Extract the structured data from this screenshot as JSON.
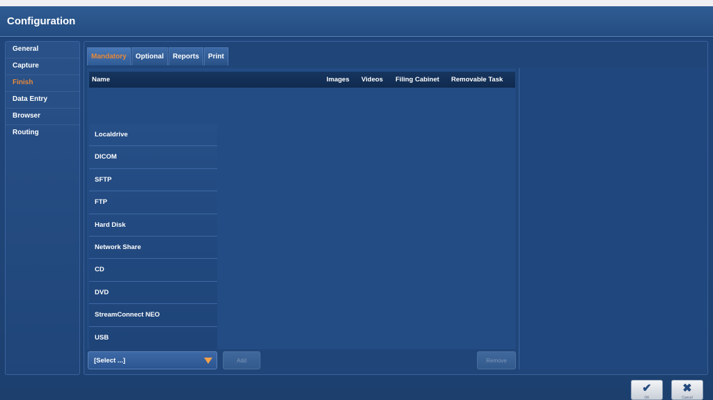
{
  "window": {
    "title": "Configuration"
  },
  "sidebar": {
    "items": [
      {
        "label": "General"
      },
      {
        "label": "Capture"
      },
      {
        "label": "Finish"
      },
      {
        "label": "Data Entry"
      },
      {
        "label": "Browser"
      },
      {
        "label": "Routing"
      }
    ],
    "active": "Finish"
  },
  "tabs": [
    {
      "label": "Mandatory"
    },
    {
      "label": "Optional"
    },
    {
      "label": "Reports"
    },
    {
      "label": "Print"
    }
  ],
  "table": {
    "columns": [
      "Name",
      "Images",
      "Videos",
      "Filing Cabinet",
      "Removable Task"
    ]
  },
  "destination_options": [
    "Localdrive",
    "DICOM",
    "SFTP",
    "FTP",
    "Hard Disk",
    "Network Share",
    "CD",
    "DVD",
    "StreamConnect NEO",
    "USB"
  ],
  "select": {
    "value": "[Select ...]"
  },
  "buttons": {
    "add": "Add",
    "remove": "Remove"
  },
  "footer": {
    "ok": "OK",
    "cancel": "Cancel"
  },
  "colors": {
    "accent": "#e8893a",
    "background": "#1f4579",
    "header": "#102a4e"
  },
  "icons": {
    "ok": "check-icon",
    "cancel": "close-icon",
    "select": "chevron-down-icon"
  }
}
